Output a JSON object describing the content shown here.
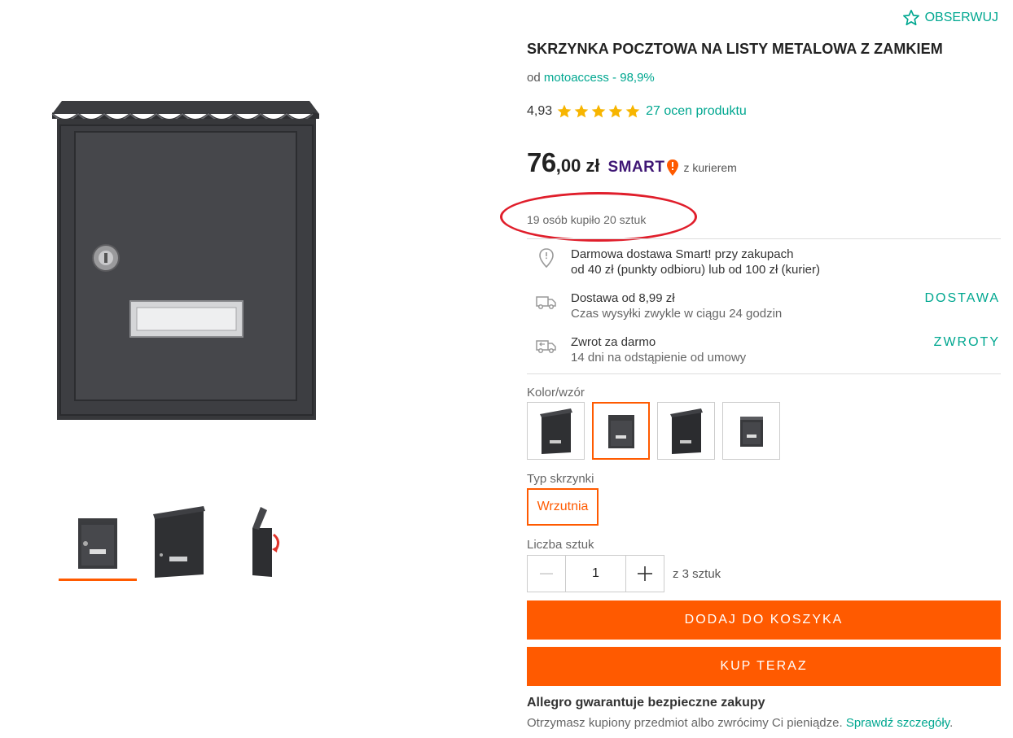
{
  "header": {
    "follow_label": "OBSERWUJ"
  },
  "product": {
    "title": "SKRZYNKA POCZTOWA NA LISTY METALOWA Z ZAMKIEM",
    "seller_prefix": "od",
    "seller_name": "motoaccess - 98,9%",
    "rating_value": "4,93",
    "rating_stars": 5,
    "rating_count_label": "27 ocen produktu",
    "price_whole": "76",
    "price_fraction": ",00",
    "price_currency": "zł",
    "smart_label": "SMART",
    "courier_label": "z kurierem",
    "bought_label": "19 osób kupiło 20 sztuk"
  },
  "delivery": {
    "free": {
      "line1": "Darmowa dostawa Smart! przy zakupach",
      "line2": "od 40 zł (punkty odbioru) lub od 100 zł (kurier)"
    },
    "shipping": {
      "line1": "Dostawa od 8,99 zł",
      "line2": "Czas wysyłki zwykle w ciągu 24 godzin",
      "link": "DOSTAWA"
    },
    "returns": {
      "line1": "Zwrot za darmo",
      "line2": "14 dni na odstąpienie od umowy",
      "link": "ZWROTY"
    }
  },
  "options": {
    "color_label": "Kolor/wzór",
    "type_label": "Typ skrzynki",
    "type_value": "Wrzutnia",
    "qty_label": "Liczba sztuk",
    "qty_value": "1",
    "qty_of": "z 3 sztuk"
  },
  "actions": {
    "add_to_cart": "DODAJ DO KOSZYKA",
    "buy_now": "KUP TERAZ"
  },
  "guarantee": {
    "title": "Allegro gwarantuje bezpieczne zakupy",
    "text": "Otrzymasz kupiony przedmiot albo zwrócimy Ci pieniądze.",
    "link": "Sprawdź szczegóły",
    "suffix": "."
  },
  "colors": {
    "accent": "#ff5a00",
    "link": "#00a790",
    "smart": "#3f1775",
    "star": "#f7b500",
    "highlight": "#e01e2b"
  }
}
